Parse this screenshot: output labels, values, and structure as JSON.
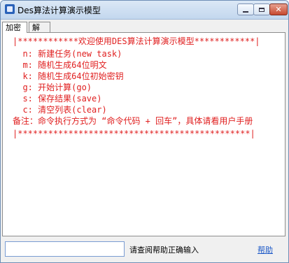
{
  "window": {
    "title": "Des算法计算演示模型",
    "controls": {
      "minimize_icon": "minimize-icon",
      "maximize_icon": "maximize-icon",
      "close_icon": "close-icon",
      "close_glyph": "✕"
    }
  },
  "tabs": [
    {
      "label": "加密",
      "active": true
    },
    {
      "label": "解密",
      "active": false
    }
  ],
  "console": {
    "lines": [
      "|************欢迎使用DES算法计算演示模型************|",
      "  n: 新建任务(new task)",
      "  m: 随机生成64位明文",
      "  k: 随机生成64位初始密钥",
      "  g: 开始计算(go)",
      "  s: 保存结果(save)",
      "  c: 清空列表(clear)",
      "备注：命令执行方式为 “命令代码 + 回车”，具体请看用户手册",
      "|**********************************************|"
    ]
  },
  "footer": {
    "input_value": "",
    "input_placeholder": "",
    "hint": "请查阅帮助正确输入",
    "help_link": "帮助"
  },
  "colors": {
    "console_text": "#e02020",
    "link": "#1a57c7"
  }
}
